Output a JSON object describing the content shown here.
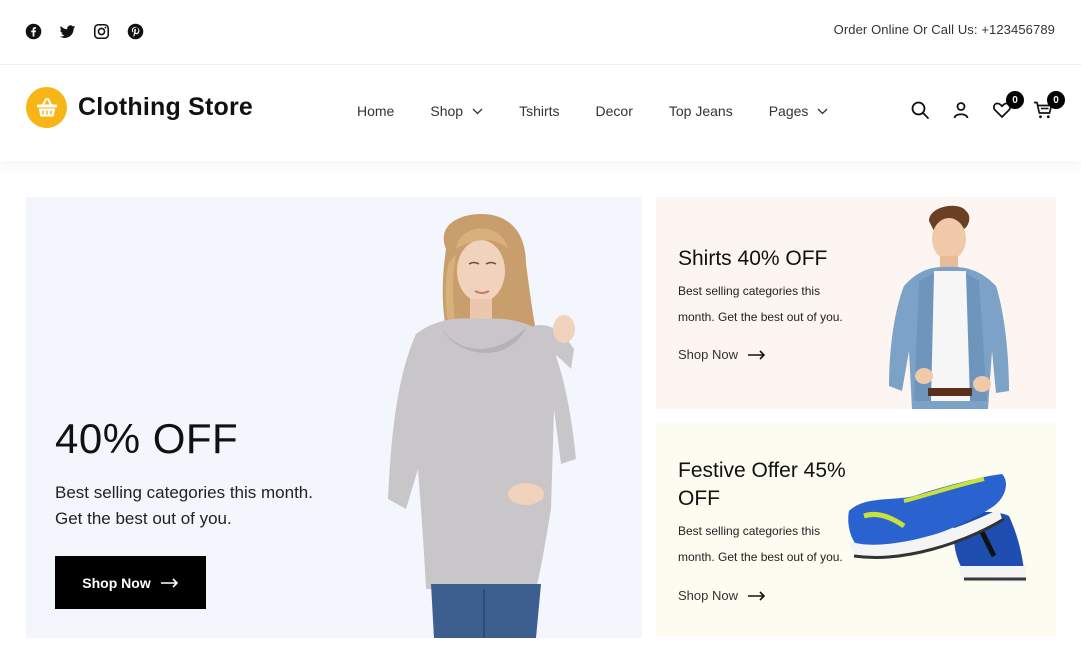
{
  "topbar": {
    "social_icons": [
      "facebook-icon",
      "twitter-icon",
      "instagram-icon",
      "pinterest-icon"
    ],
    "contact_text": "Order Online Or Call Us: +123456789"
  },
  "header": {
    "logo_text": "Clothing Store",
    "logo_color": "#f7b516",
    "nav": [
      {
        "label": "Home",
        "dropdown": false
      },
      {
        "label": "Shop",
        "dropdown": true
      },
      {
        "label": "Tshirts",
        "dropdown": false
      },
      {
        "label": "Decor",
        "dropdown": false
      },
      {
        "label": "Top Jeans",
        "dropdown": false
      },
      {
        "label": "Pages",
        "dropdown": true
      }
    ],
    "wishlist_count": "0",
    "cart_count": "0"
  },
  "hero": {
    "title": "40% OFF",
    "text": "Best selling categories this month. Get the best out of you.",
    "button_label": "Shop Now",
    "background": "#f3f6fc"
  },
  "promos": [
    {
      "title": "Shirts 40% OFF",
      "text": "Best selling categories this month. Get the best out of you.",
      "link_label": "Shop Now",
      "background": "#fdf5f1"
    },
    {
      "title": "Festive Offer 45% OFF",
      "text": "Best selling categories this month. Get the best out of you.",
      "link_label": "Shop Now",
      "background": "#fcfcf0"
    }
  ]
}
